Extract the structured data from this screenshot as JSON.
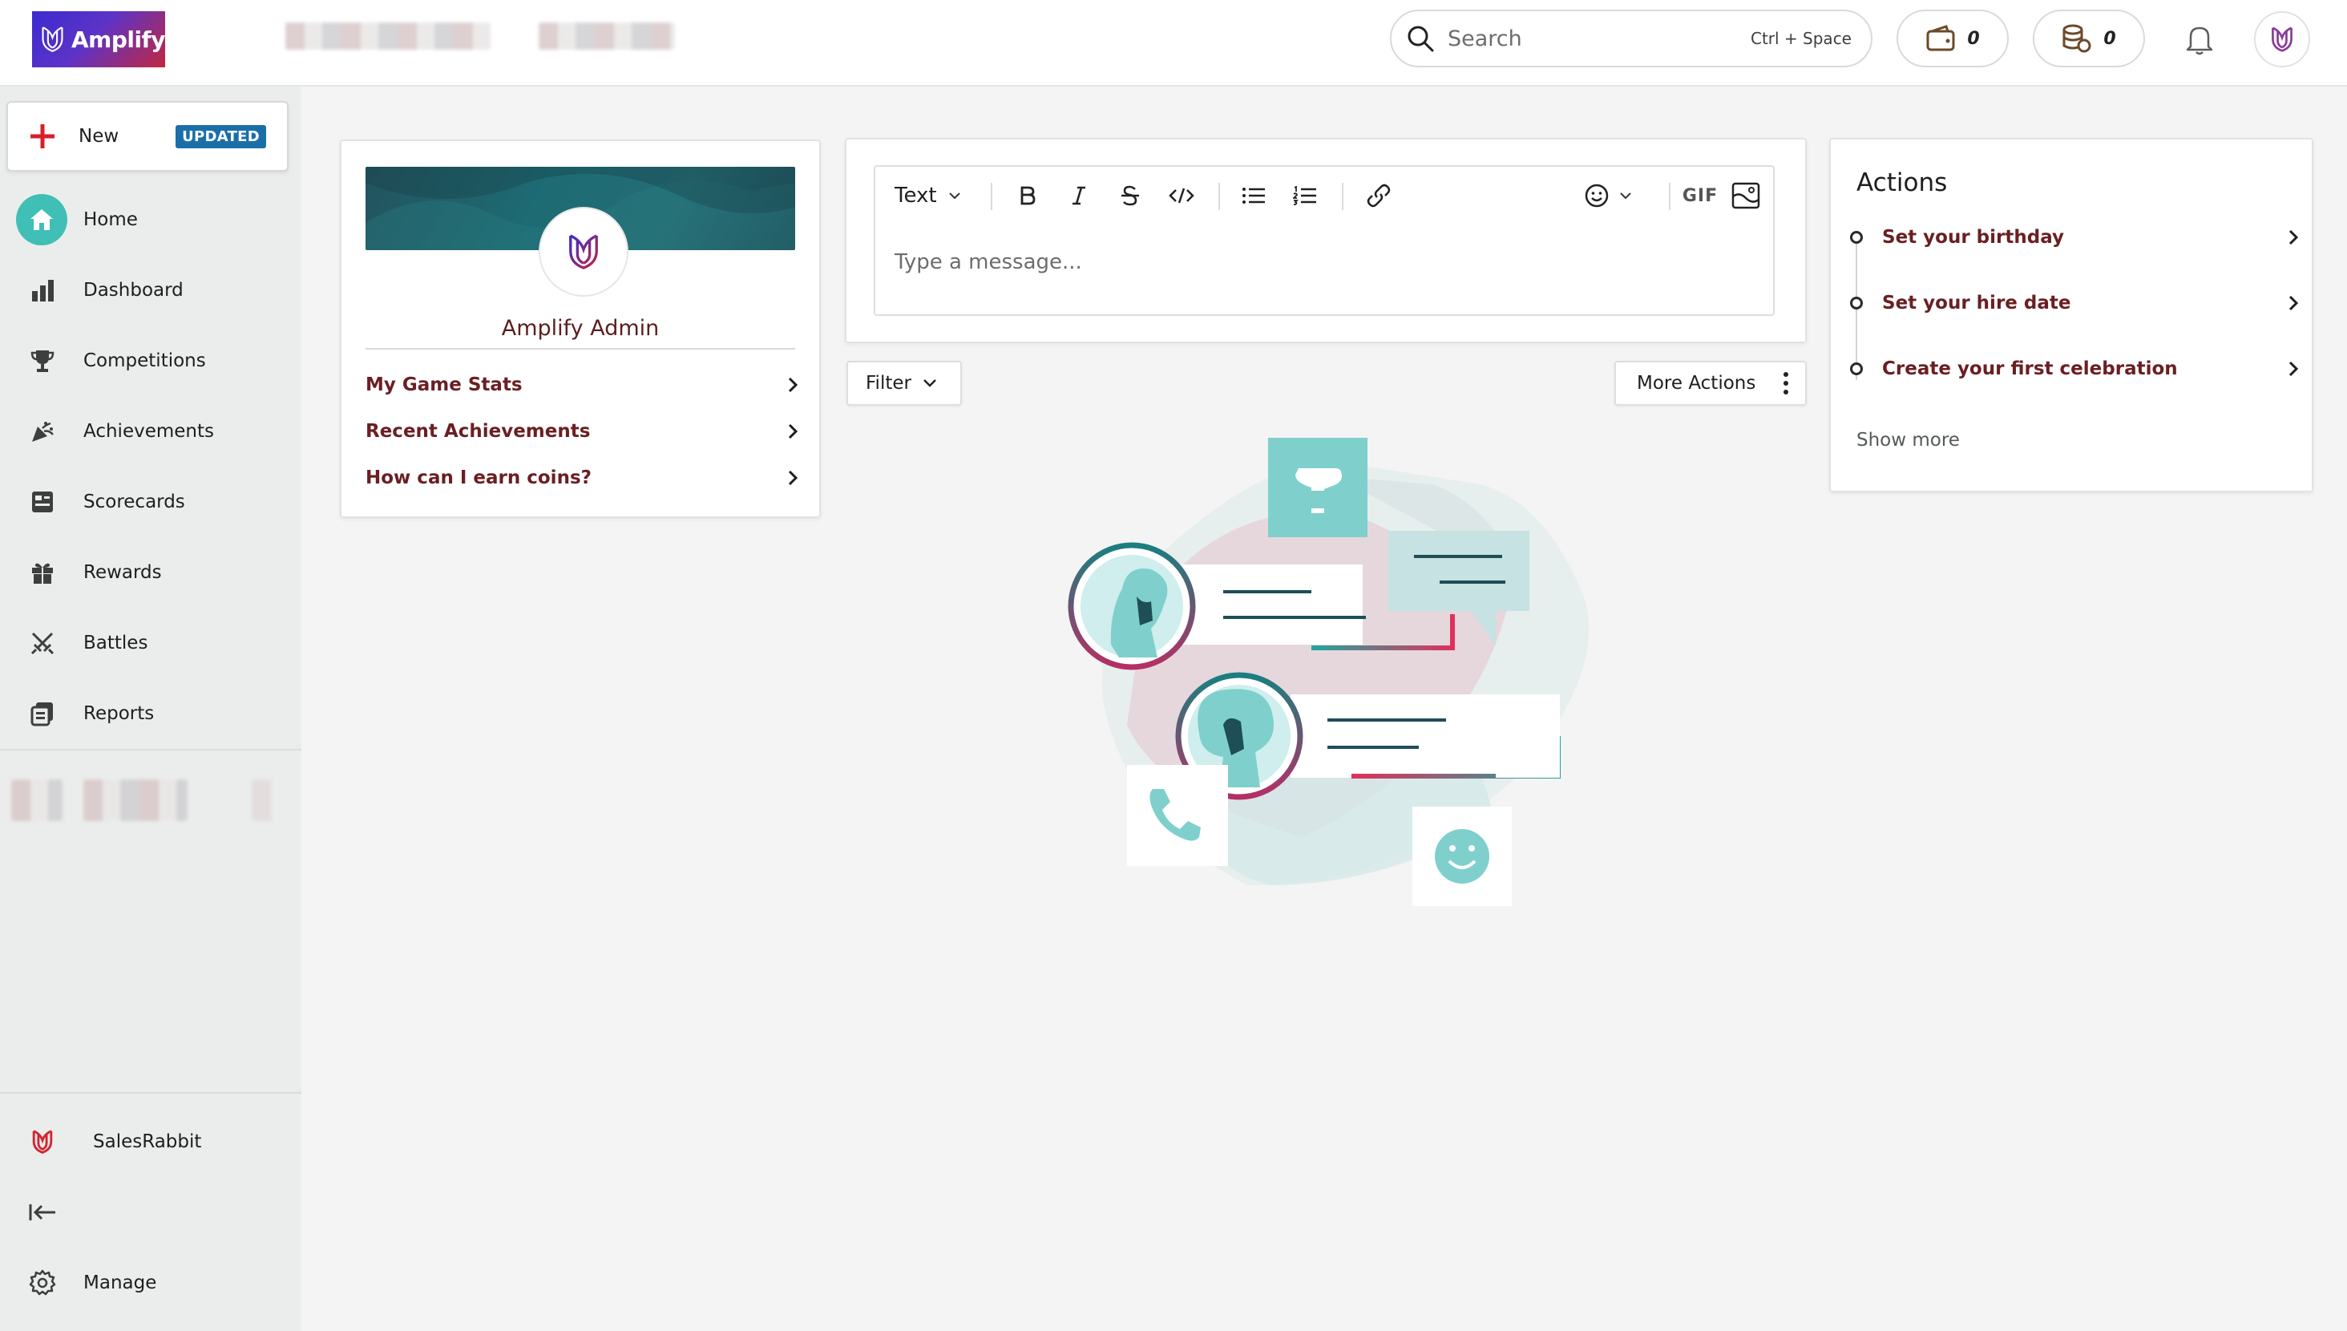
{
  "app": {
    "name": "Amplify",
    "accent": "#6a1f22",
    "teal": "#3fbfb5"
  },
  "topbar": {
    "search_placeholder": "Search",
    "search_hint": "Ctrl + Space",
    "wallet_count": "0",
    "coins_count": "0",
    "icons": [
      "search-icon",
      "wallet-icon",
      "coins-icon",
      "bell-icon",
      "avatar"
    ]
  },
  "sidebar": {
    "new_label": "New",
    "new_badge": "UPDATED",
    "items": [
      {
        "label": "Home",
        "icon": "home-icon"
      },
      {
        "label": "Dashboard",
        "icon": "bar-chart-icon"
      },
      {
        "label": "Competitions",
        "icon": "trophy-icon"
      },
      {
        "label": "Achievements",
        "icon": "party-icon"
      },
      {
        "label": "Scorecards",
        "icon": "scorecard-icon"
      },
      {
        "label": "Rewards",
        "icon": "gift-icon"
      },
      {
        "label": "Battles",
        "icon": "swords-icon"
      },
      {
        "label": "Reports",
        "icon": "reports-icon"
      }
    ],
    "org_label": "SalesRabbit",
    "manage_label": "Manage"
  },
  "profile": {
    "name": "Amplify Admin",
    "links": [
      "My Game Stats",
      "Recent Achievements",
      "How can I earn coins?"
    ]
  },
  "composer": {
    "format_label": "Text",
    "gif_label": "GIF",
    "placeholder": "Type a message..."
  },
  "feed": {
    "filter_label": "Filter",
    "more_actions_label": "More Actions"
  },
  "actions": {
    "title": "Actions",
    "items": [
      "Set your birthday",
      "Set your hire date",
      "Create your first celebration"
    ],
    "show_more": "Show more"
  }
}
